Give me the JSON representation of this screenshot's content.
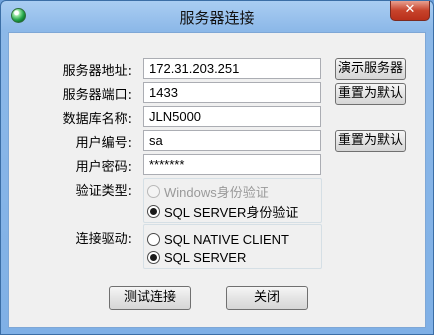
{
  "window": {
    "title": "服务器连接",
    "close_glyph": "✕"
  },
  "form": {
    "server_address_label": "服务器地址:",
    "server_address_value": "172.31.203.251",
    "server_port_label": "服务器端口:",
    "server_port_value": "1433",
    "database_name_label": "数据库名称:",
    "database_name_value": "JLN5000",
    "user_id_label": "用户编号:",
    "user_id_value": "sa",
    "password_label": "用户密码:",
    "password_value": "*******",
    "auth_type_label": "验证类型:",
    "driver_label": "连接驱动:"
  },
  "buttons": {
    "demo_server": "演示服务器",
    "reset_default_1": "重置为默认",
    "reset_default_2": "重置为默认",
    "test_connection": "测试连接",
    "close": "关闭"
  },
  "auth_options": [
    {
      "label": "Windows身份验证",
      "checked": false,
      "disabled": true
    },
    {
      "label": "SQL SERVER身份验证",
      "checked": true,
      "disabled": false
    }
  ],
  "driver_options": [
    {
      "label": "SQL NATIVE CLIENT",
      "checked": false
    },
    {
      "label": "SQL SERVER",
      "checked": true
    }
  ],
  "colors": {
    "titlebar": "#8cb8e8",
    "close_button": "#c7432b",
    "client_bg": "#f0f0f0"
  }
}
